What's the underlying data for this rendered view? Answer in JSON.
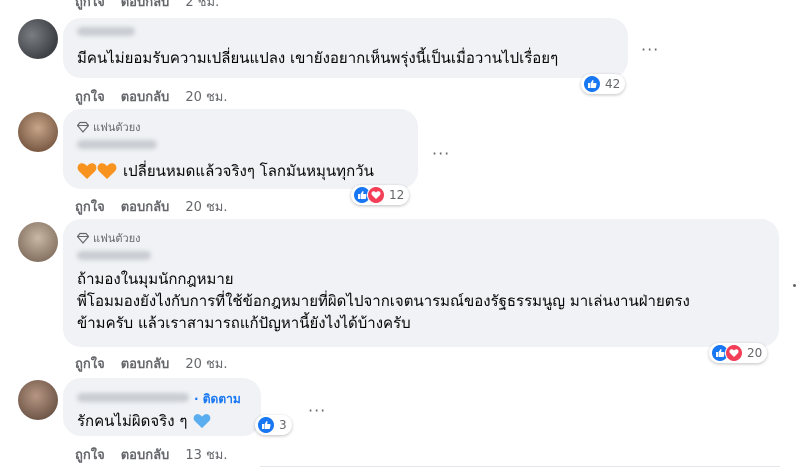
{
  "top_row": {
    "like": "ถูกใจ",
    "reply": "ตอบกลับ",
    "time": "2 ชม."
  },
  "comments": [
    {
      "text_lines": [
        "มีคนไม่ยอมรับความเปลี่ยนแปลง เขายังอยากเห็นพรุ่งนี้เป็นเมื่อวานไปเรื่อยๆ"
      ],
      "reaction_count": "42",
      "like": "ถูกใจ",
      "reply": "ตอบกลับ",
      "time": "20 ชม."
    },
    {
      "badge": "แฟนตัวยง",
      "text_lines": [
        "เปลี่ยนหมดแล้วจริงๆ โลกมันหมุนทุกวัน"
      ],
      "reaction_count": "12",
      "like": "ถูกใจ",
      "reply": "ตอบกลับ",
      "time": "20 ชม."
    },
    {
      "badge": "แฟนตัวยง",
      "text_lines": [
        "ถ้ามองในมุมนักกฎหมาย",
        "พี่โอมมองยังไงกับการที่ใช้ข้อกฎหมายที่ผิดไปจากเจตนารมณ์ของรัฐธรรมนูญ มาเล่นงานฝ่ายตรง",
        "ข้ามครับ แล้วเราสามารถแก้ปัญหานี้ยังไงได้บ้างครับ"
      ],
      "reaction_count": "20",
      "like": "ถูกใจ",
      "reply": "ตอบกลับ",
      "time": "20 ชม."
    },
    {
      "follow_label": "· ติดตาม",
      "text_lines": [
        "รักคนไม่ผิดจริง ๆ"
      ],
      "reaction_count": "3",
      "like": "ถูกใจ",
      "reply": "ตอบกลับ",
      "time": "13 ชม."
    }
  ],
  "more_label": "···",
  "colors": {
    "bubble": "#f0f2f5",
    "meta": "#65676b",
    "like_blue": "#1877f2",
    "love_red": "#f33e58",
    "follow": "#1877f2"
  },
  "icons": [
    "diamond-icon",
    "orange-heart-icon",
    "blue-heart-icon",
    "like-reaction-icon",
    "love-reaction-icon",
    "more-options-icon"
  ]
}
